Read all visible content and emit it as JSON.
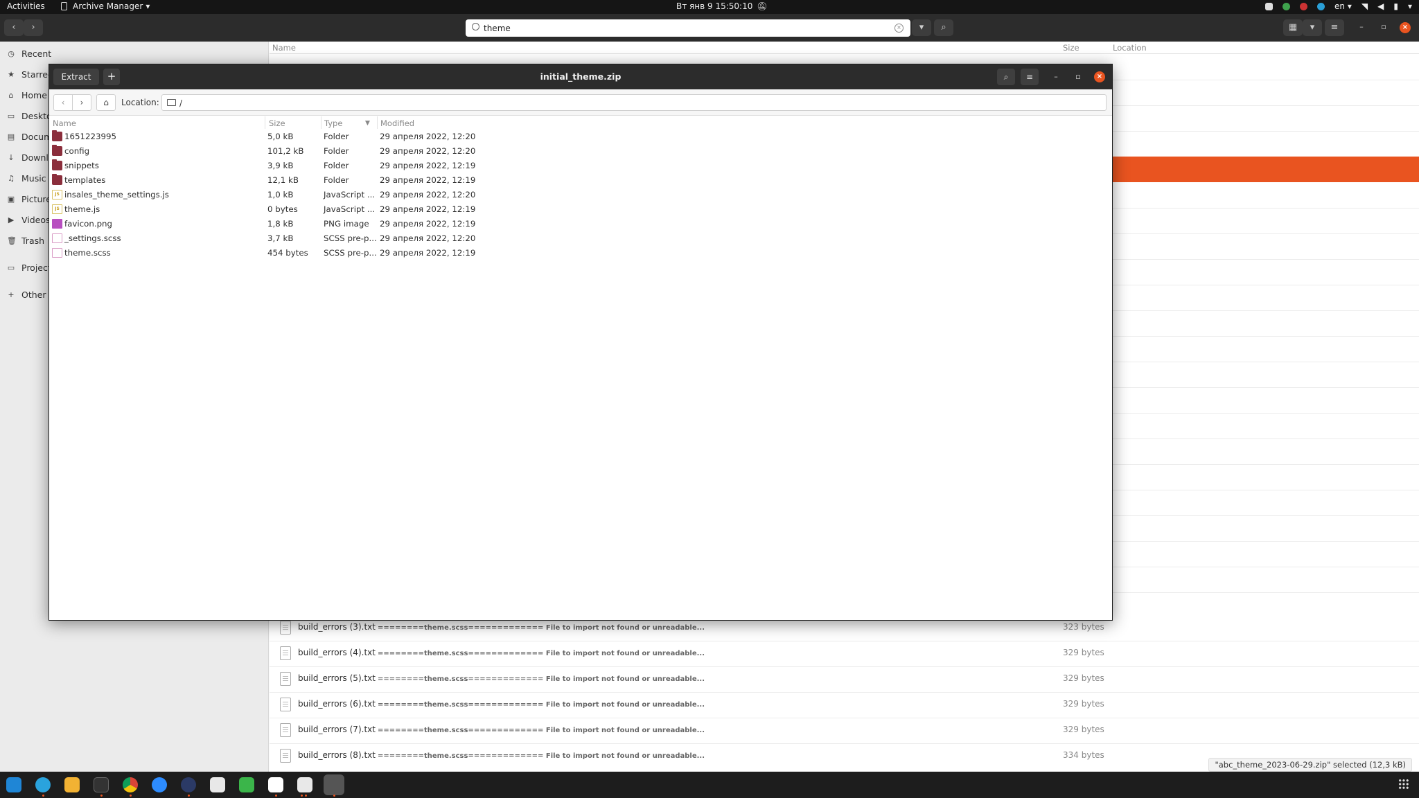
{
  "topbar": {
    "activities": "Activities",
    "app_name": "Archive Manager",
    "clock": "Вт янв 9  15:50:10",
    "lang": "en"
  },
  "nautilus": {
    "search_value": "theme",
    "sidebar": [
      "Recent",
      "Starred",
      "Home",
      "Desktop",
      "Documents",
      "Downloads",
      "Music",
      "Pictures",
      "Videos",
      "Trash",
      "Projects",
      "Other Locations"
    ],
    "columns": {
      "name": "Name",
      "size": "Size",
      "location": "Location"
    },
    "bg_rows": [
      {
        "name": "build_errors (3).txt",
        "note": "========theme.scss============= File to import not found or unreadable...",
        "size": "323 bytes"
      },
      {
        "name": "build_errors (4).txt",
        "note": "========theme.scss============= File to import not found or unreadable...",
        "size": "329 bytes"
      },
      {
        "name": "build_errors (5).txt",
        "note": "========theme.scss============= File to import not found or unreadable...",
        "size": "329 bytes"
      },
      {
        "name": "build_errors (6).txt",
        "note": "========theme.scss============= File to import not found or unreadable...",
        "size": "329 bytes"
      },
      {
        "name": "build_errors (7).txt",
        "note": "========theme.scss============= File to import not found or unreadable...",
        "size": "329 bytes"
      },
      {
        "name": "build_errors (8).txt",
        "note": "========theme.scss============= File to import not found or unreadable...",
        "size": "334 bytes"
      }
    ],
    "status": "\"abc_theme_2023-06-29.zip\" selected (12,3 kB)"
  },
  "archive": {
    "title": "initial_theme.zip",
    "extract_label": "Extract",
    "add_label": "+",
    "location_label": "Location:",
    "location_value": "/",
    "columns": {
      "name": "Name",
      "size": "Size",
      "type": "Type",
      "modified": "Modified"
    },
    "files": [
      {
        "icon": "folder",
        "name": "1651223995",
        "size": "5,0 kB",
        "type": "Folder",
        "modified": "29 апреля 2022, 12:20"
      },
      {
        "icon": "folder",
        "name": "config",
        "size": "101,2 kB",
        "type": "Folder",
        "modified": "29 апреля 2022, 12:20"
      },
      {
        "icon": "folder",
        "name": "snippets",
        "size": "3,9 kB",
        "type": "Folder",
        "modified": "29 апреля 2022, 12:19"
      },
      {
        "icon": "folder",
        "name": "templates",
        "size": "12,1 kB",
        "type": "Folder",
        "modified": "29 апреля 2022, 12:19"
      },
      {
        "icon": "js",
        "name": "insales_theme_settings.js",
        "size": "1,0 kB",
        "type": "JavaScript ...",
        "modified": "29 апреля 2022, 12:20"
      },
      {
        "icon": "js",
        "name": "theme.js",
        "size": "0 bytes",
        "type": "JavaScript ...",
        "modified": "29 апреля 2022, 12:19"
      },
      {
        "icon": "png",
        "name": "favicon.png",
        "size": "1,8 kB",
        "type": "PNG image",
        "modified": "29 апреля 2022, 12:19"
      },
      {
        "icon": "scss",
        "name": "_settings.scss",
        "size": "3,7 kB",
        "type": "SCSS pre-p...",
        "modified": "29 апреля 2022, 12:20"
      },
      {
        "icon": "scss",
        "name": "theme.scss",
        "size": "454 bytes",
        "type": "SCSS pre-p...",
        "modified": "29 апреля 2022, 12:19"
      }
    ]
  },
  "colors": {
    "accent": "#e95420",
    "headerbar": "#2c2c2c",
    "folder": "#8b2e3c"
  }
}
